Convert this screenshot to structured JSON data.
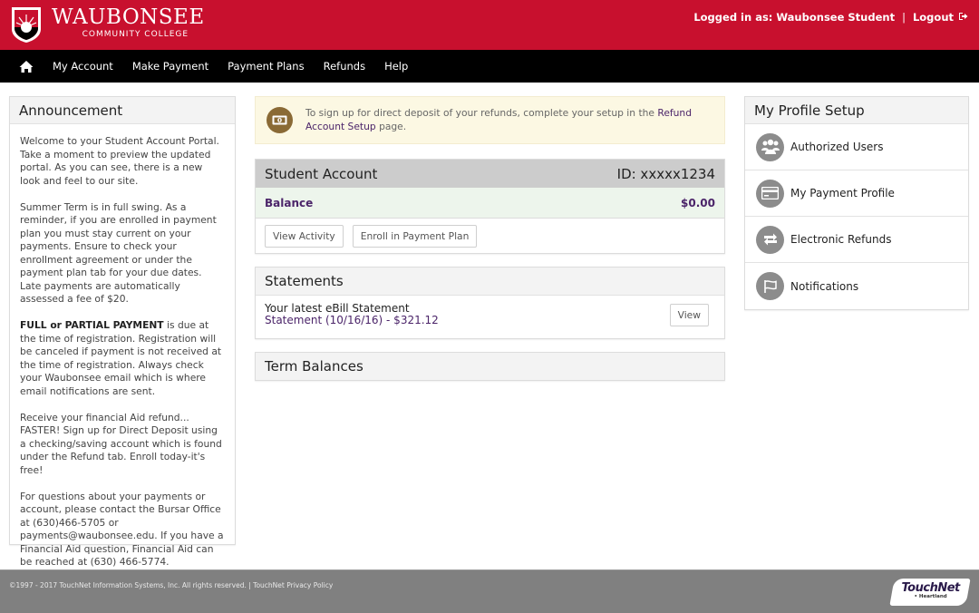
{
  "header": {
    "logo_title": "WAUBONSEE",
    "logo_subtitle": "COMMUNITY COLLEGE",
    "logged_in_text": "Logged in as: Waubonsee Student",
    "separator": "|",
    "logout_label": "Logout",
    "brand_color": "#c8102e"
  },
  "nav": {
    "home_icon": "home-icon",
    "items": [
      {
        "label": "My Account"
      },
      {
        "label": "Make Payment"
      },
      {
        "label": "Payment Plans"
      },
      {
        "label": "Refunds"
      },
      {
        "label": "Help"
      }
    ]
  },
  "announcement": {
    "title": "Announcement",
    "p1": "Welcome to your Student Account Portal. Take a moment to preview the updated portal. As you can see, there is a new look and feel to our site.",
    "p2": "Summer Term is in full swing. As a reminder, if you are enrolled in payment plan you must stay current on your payments. Ensure to check your enrollment agreement or under the payment plan tab for your due dates. Late payments are automatically assessed a fee of $20.",
    "p3_bold": "FULL or PARTIAL PAYMENT",
    "p3_rest": " is due at the time of registration. Registration will be canceled if payment is not received at the time of registration. Always check your Waubonsee email which is where email notifications are sent.",
    "p4": "Receive your financial Aid refund... FASTER! Sign up for Direct Deposit using a checking/saving account which is found under the Refund tab. Enroll today-it's free!",
    "p5": "For questions about your payments or account, please contact the Bursar Office at (630)466-5705 or payments@waubonsee.edu. If you have a Financial Aid question, Financial Aid can be reached at (630) 466-5774."
  },
  "alert": {
    "icon": "money-icon",
    "text_before": "To sign up for direct deposit of your refunds, complete your setup in the ",
    "link_text": "Refund Account Setup",
    "text_after": " page."
  },
  "student_account": {
    "title": "Student Account",
    "id_text": "ID: xxxxx1234",
    "balance_label": "Balance",
    "balance_value": "$0.00",
    "view_activity_label": "View Activity",
    "enroll_label": "Enroll in Payment Plan"
  },
  "statements": {
    "title": "Statements",
    "latest_label": "Your latest eBill Statement",
    "statement_link": "Statement (10/16/16) - $321.12",
    "view_label": "View"
  },
  "term_balances": {
    "title": "Term Balances"
  },
  "profile": {
    "title": "My Profile Setup",
    "items": [
      {
        "label": "Authorized Users",
        "icon": "users-icon"
      },
      {
        "label": "My Payment Profile",
        "icon": "credit-card-icon"
      },
      {
        "label": "Electronic Refunds",
        "icon": "refund-exchange-icon"
      },
      {
        "label": "Notifications",
        "icon": "flag-icon"
      }
    ]
  },
  "footer": {
    "copyright": "©1997 - 2017  TouchNet Information Systems, Inc. All rights reserved. | ",
    "privacy_link": "TouchNet Privacy Policy",
    "touchnet_logo": "TouchNet",
    "touchnet_sub": "• Heartland"
  }
}
